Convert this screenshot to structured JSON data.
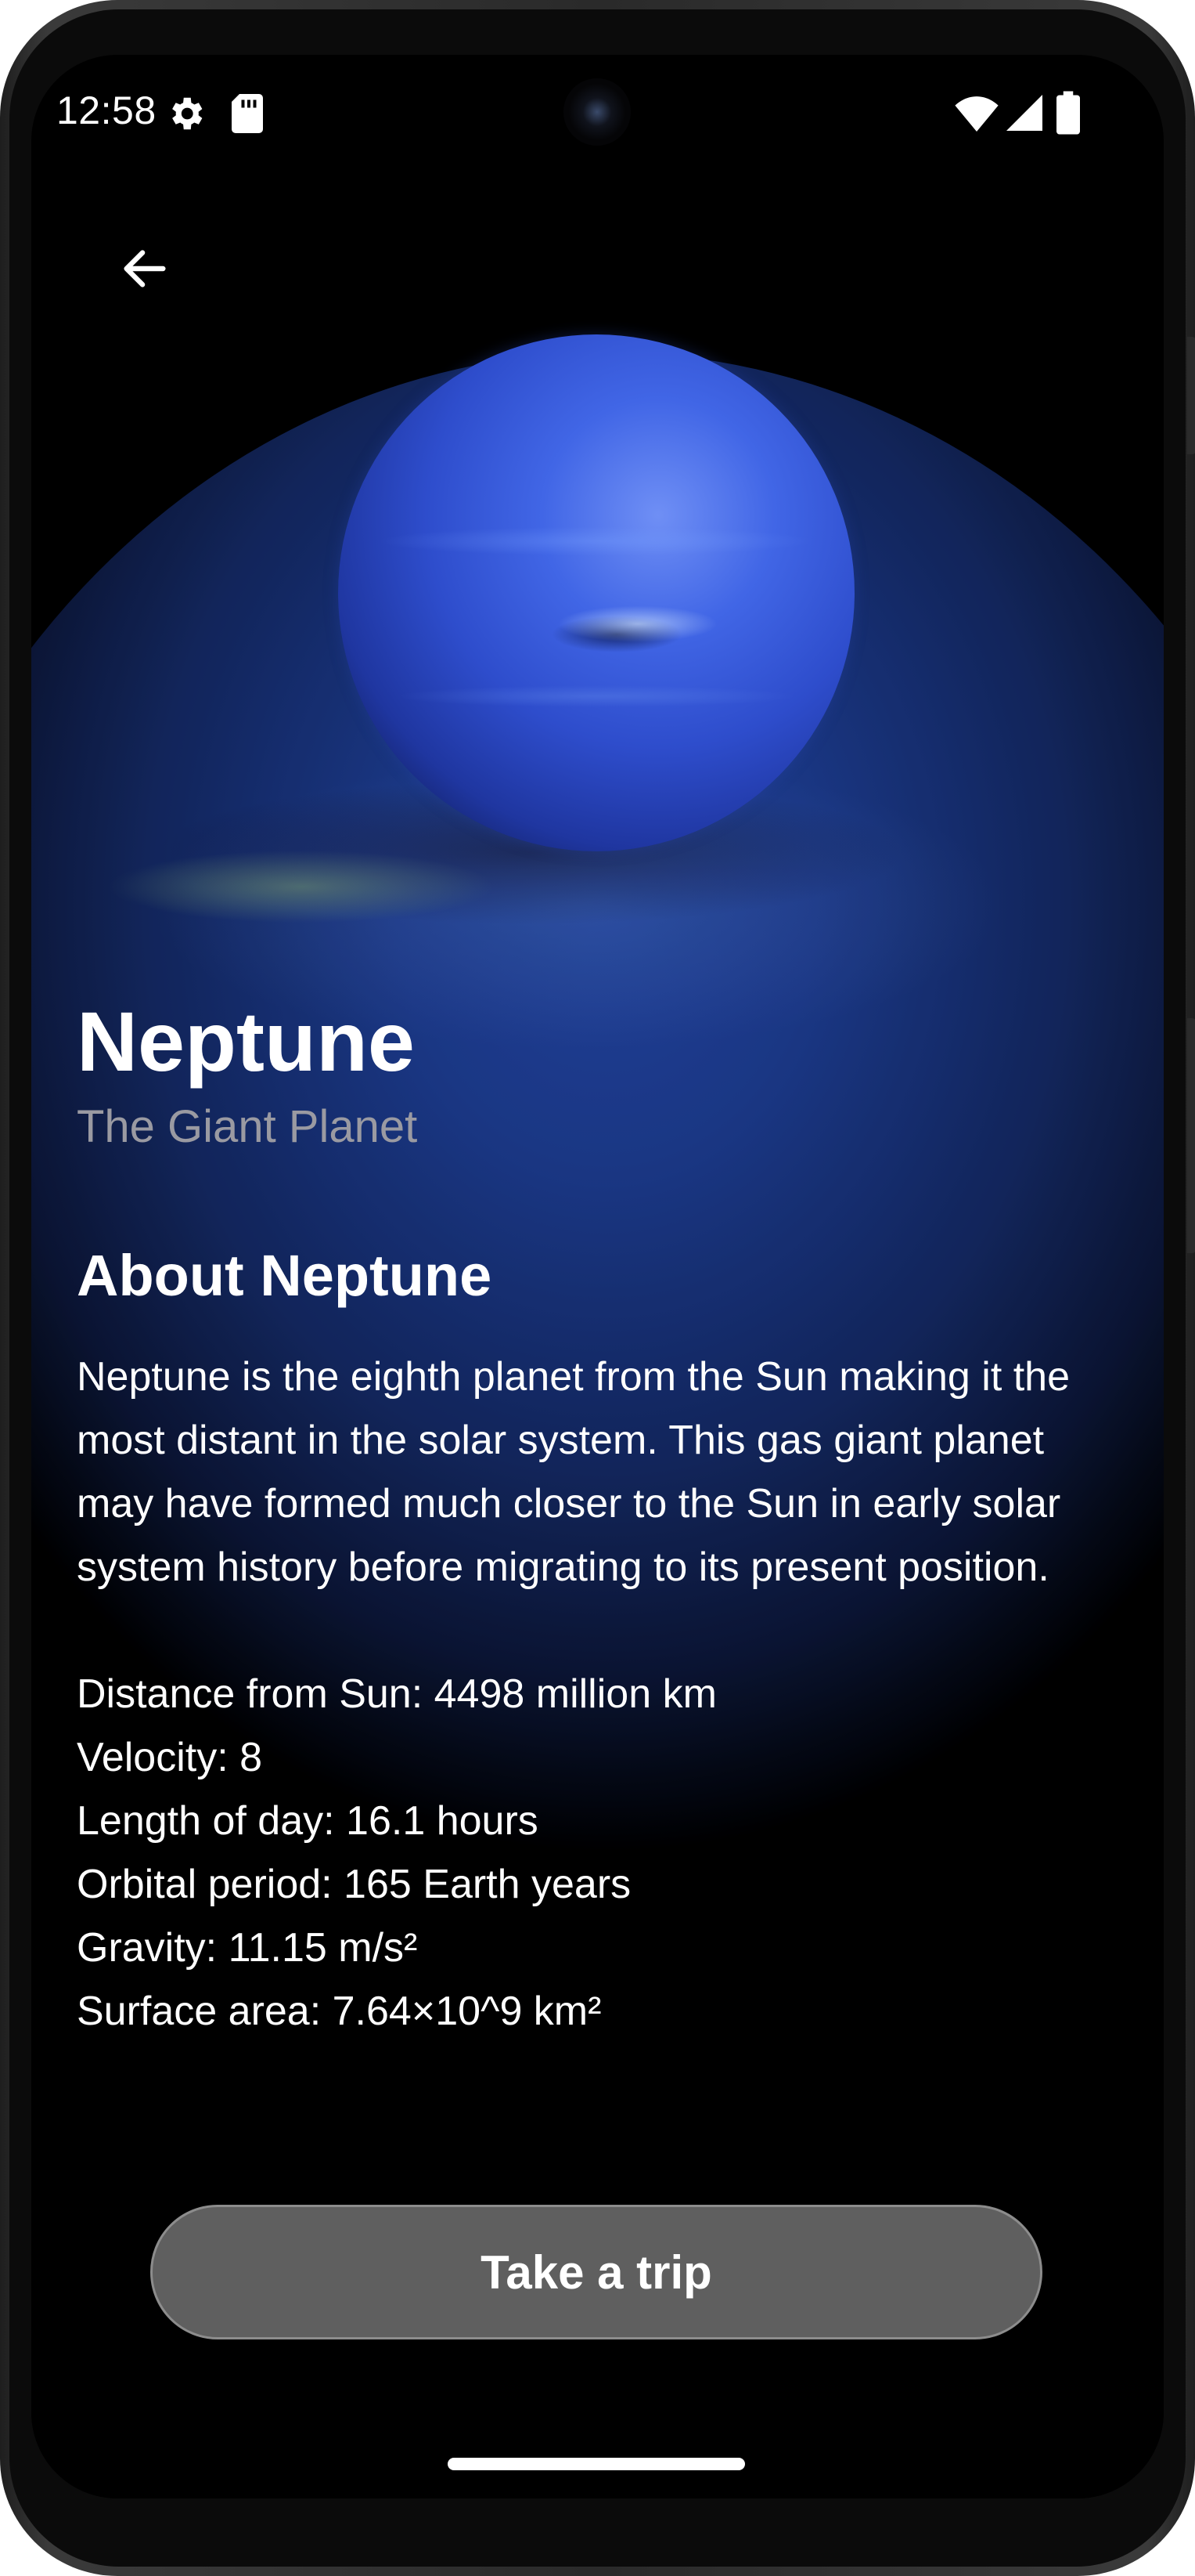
{
  "status_bar": {
    "time": "12:58",
    "icons": [
      "settings-gear-icon",
      "sd-card-icon",
      "wifi-icon",
      "cellular-signal-icon",
      "battery-icon"
    ]
  },
  "navigation": {
    "back_icon": "arrow-left-icon"
  },
  "planet": {
    "name": "Neptune",
    "subtitle": "The Giant Planet",
    "image": "neptune-planet-image"
  },
  "about": {
    "heading": "About Neptune",
    "text": "Neptune is the eighth planet from the Sun making it the most distant in the solar system. This gas giant planet may have formed much closer to the Sun in early solar system history before migrating to its present position."
  },
  "stats": [
    "Distance from Sun: 4498 million km",
    "Velocity: 8",
    "Length of day: 16.1 hours",
    "Orbital period: 165 Earth years",
    "Gravity: 11.15 m/s²",
    "Surface area: 7.64×10^9 km²"
  ],
  "actions": {
    "trip_button_label": "Take a trip"
  },
  "colors": {
    "background": "#000000",
    "button": "#5f5f5f",
    "subtitle": "#9a9aa2",
    "text": "#ffffff"
  }
}
